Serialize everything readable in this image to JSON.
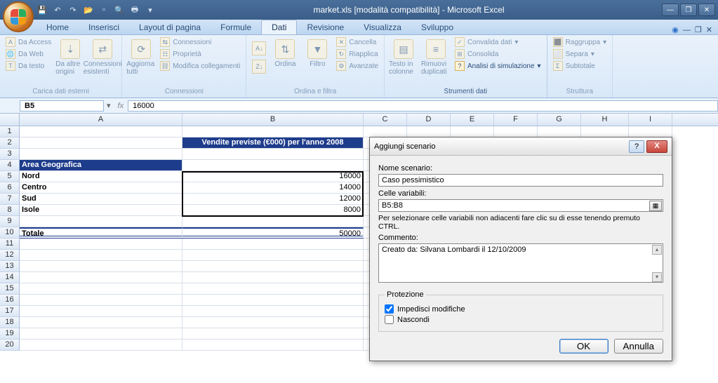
{
  "title": "market.xls [modalità compatibilità] - Microsoft Excel",
  "tabs": [
    "Home",
    "Inserisci",
    "Layout di pagina",
    "Formule",
    "Dati",
    "Revisione",
    "Visualizza",
    "Sviluppo"
  ],
  "active_tab": "Dati",
  "ribbon": {
    "ext": {
      "access": "Da Access",
      "web": "Da Web",
      "text": "Da testo",
      "other": "Da altre origini",
      "existing": "Connessioni esistenti",
      "label": "Carica dati esterni"
    },
    "conn": {
      "refresh": "Aggiorna tutti",
      "conns": "Connessioni",
      "props": "Proprietà",
      "edit": "Modifica collegamenti",
      "label": "Connessioni"
    },
    "sort": {
      "sort": "Ordina",
      "filter": "Filtro",
      "clear": "Cancella",
      "reapply": "Riapplica",
      "adv": "Avanzate",
      "label": "Ordina e filtra"
    },
    "tools": {
      "ttc": "Testo in colonne",
      "dup": "Rimuovi duplicati",
      "valid": "Convalida dati",
      "consol": "Consolida",
      "whatif": "Analisi di simulazione",
      "label": "Strumenti dati"
    },
    "struct": {
      "group": "Raggruppa",
      "ungroup": "Separa",
      "subtotal": "Subtotale",
      "label": "Struttura"
    }
  },
  "formula_bar": {
    "name": "B5",
    "fx": "fx",
    "value": "16000"
  },
  "columns": [
    "A",
    "B",
    "C",
    "D",
    "E",
    "F",
    "G",
    "H",
    "I"
  ],
  "sheet": {
    "b2": "Vendite previste (€000) per l'anno 2008",
    "a4": "Area Geografica",
    "rows": [
      {
        "a": "Nord",
        "b": "16000"
      },
      {
        "a": "Centro",
        "b": "14000"
      },
      {
        "a": "Sud",
        "b": "12000"
      },
      {
        "a": "Isole",
        "b": "8000"
      }
    ],
    "total_label": "Totale",
    "total_value": "50000"
  },
  "dialog": {
    "title": "Aggiungi scenario",
    "name_label": "Nome scenario:",
    "name_value": "Caso pessimistico",
    "vars_label": "Celle variabili:",
    "vars_value": "B5:B8",
    "hint": "Per selezionare celle variabili non adiacenti fare clic su di esse tenendo premuto CTRL.",
    "comment_label": "Commento:",
    "comment_value": "Creato da: Silvana Lombardi il 12/10/2009",
    "prot_label": "Protezione",
    "chk1": "Impedisci modifiche",
    "chk2": "Nascondi",
    "ok": "OK",
    "cancel": "Annulla"
  }
}
